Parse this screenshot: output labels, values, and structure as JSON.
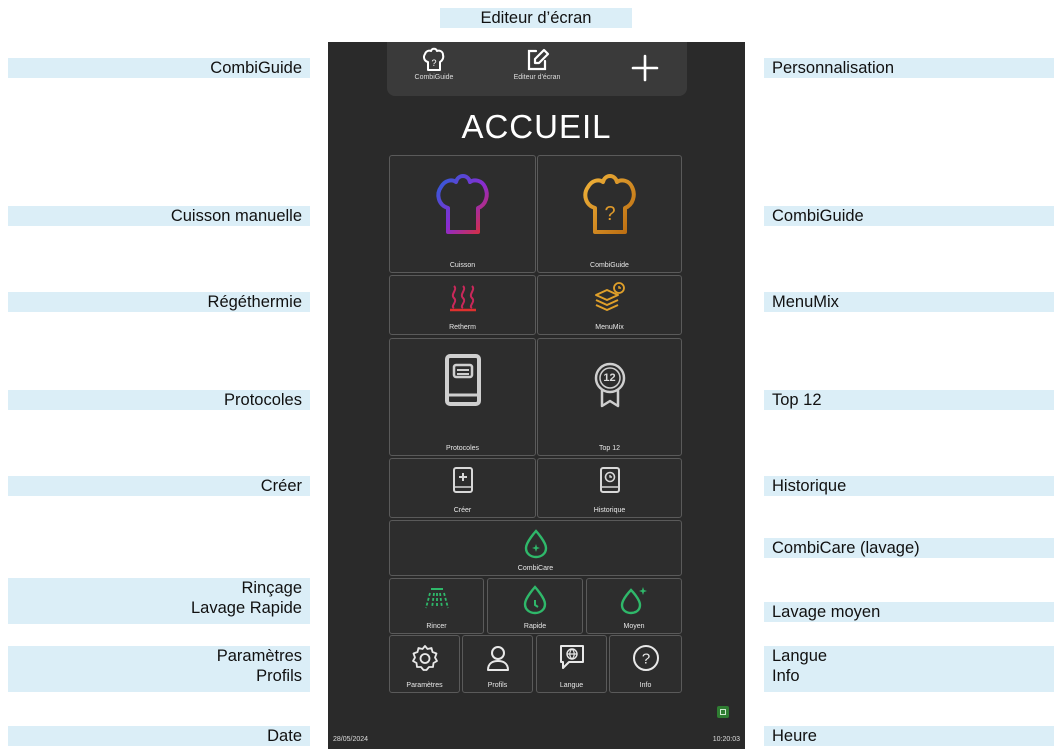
{
  "callouts": {
    "top": "Editeur d’écran",
    "left": {
      "combiguide": "CombiGuide",
      "cuisson": "Cuisson manuelle",
      "regethermie": "Régéthermie",
      "protocoles": "Protocoles",
      "creer": "Créer",
      "rincage": "Rinçage",
      "lavage_rapide": "Lavage Rapide",
      "parametres": "Paramètres",
      "profils": "Profils",
      "date": "Date"
    },
    "right": {
      "personnalisation": "Personnalisation",
      "combiguide": "CombiGuide",
      "menumix": "MenuMix",
      "top12": "Top 12",
      "historique": "Historique",
      "combicare": "CombiCare (lavage)",
      "lavage_moyen": "Lavage moyen",
      "langue": "Langue",
      "info": "Info",
      "heure": "Heure"
    }
  },
  "screen": {
    "topbar": {
      "combiguide": "CombiGuide",
      "editeur": "Editeur d'écran"
    },
    "title": "ACCUEIL",
    "tiles": {
      "cuisson": "Cuisson",
      "combiguide": "CombiGuide",
      "retherm": "Retherm",
      "menumix": "MenuMix",
      "protocoles": "Protocoles",
      "top12": "Top 12",
      "top12_number": "12",
      "creer": "Créer",
      "historique": "Historique",
      "combicare": "CombiCare",
      "rincer": "Rincer",
      "rapide": "Rapide",
      "moyen": "Moyen",
      "parametres": "Paramètres",
      "profils": "Profils",
      "langue": "Langue",
      "info": "Info"
    },
    "date": "28/05/2024",
    "time": "10:20:03"
  },
  "colors": {
    "callout_bg": "#dbeef7",
    "screen_bg": "#2a2a2a",
    "accent_gold": "#d99a2b",
    "accent_green": "#2fb86a",
    "accent_red": "#e0302e",
    "accent_blue": "#2a5fd8"
  }
}
